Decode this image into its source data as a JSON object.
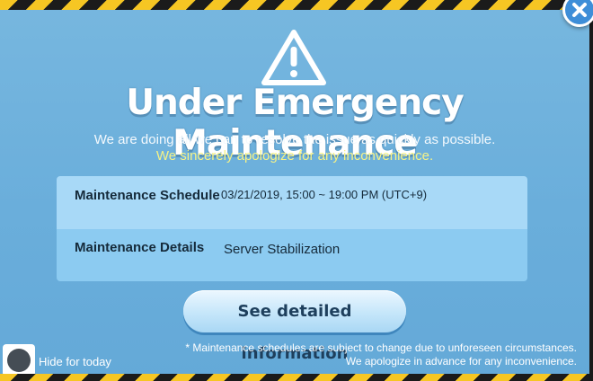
{
  "dialog": {
    "title": "Under Emergency Maintenance",
    "subtitle_line1": "We are doing all we can to resolve the issue as quickly as possible.",
    "subtitle_line2": "We sincerely apologize for any inconvenience.",
    "icons": {
      "warning": "warning-triangle-icon",
      "close": "close-x-icon"
    },
    "colors": {
      "hazard_yellow": "#f6c623",
      "hazard_black": "#1b1b1b",
      "highlight_text": "#f5f287"
    }
  },
  "info": {
    "schedule_label": "Maintenance Schedule",
    "schedule_value": "03/21/2019, 15:00 ~ 19:00 PM (UTC+9)",
    "details_label": "Maintenance Details",
    "details_value": "Server Stabilization"
  },
  "actions": {
    "details_button": "See detailed information",
    "hide_today_label": "Hide for today"
  },
  "notes": {
    "line1": "* Maintenance schedules are subject to change due to unforeseen circumstances.",
    "line2": "We apologize in advance for any inconvenience."
  }
}
